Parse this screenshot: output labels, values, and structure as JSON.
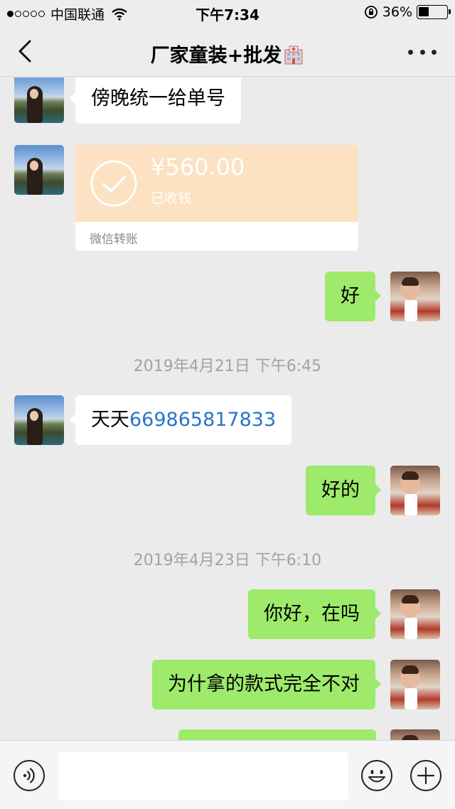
{
  "status_bar": {
    "signal_dots_filled": 1,
    "signal_dots_total": 5,
    "carrier": "中国联通",
    "time": "下午7:34",
    "battery_percent": "36%",
    "battery_level": 0.36
  },
  "nav": {
    "title": "厂家童装+批发",
    "title_emoji": "hospital-icon"
  },
  "messages": [
    {
      "side": "in",
      "text": "傍晚统一给单号"
    },
    {
      "side": "in",
      "type": "transfer",
      "amount": "¥560.00",
      "status": "已收钱",
      "footer": "微信转账"
    },
    {
      "side": "out",
      "text": "好"
    },
    {
      "type": "timestamp",
      "text": "2019年4月21日 下午6:45"
    },
    {
      "side": "in",
      "text_prefix": "天天",
      "link": "669865817833"
    },
    {
      "side": "out",
      "text": "好的"
    },
    {
      "type": "timestamp",
      "text": "2019年4月23日 下午6:10"
    },
    {
      "side": "out",
      "text": "你好，在吗"
    },
    {
      "side": "out",
      "text": "为什拿的款式完全不对"
    }
  ],
  "input_bar": {
    "value": "",
    "icons": [
      "voice-icon",
      "emoji-icon",
      "plus-icon"
    ]
  },
  "colors": {
    "outgoing_bubble": "#9eea6a",
    "incoming_bubble": "#ffffff",
    "transfer_card": "#fce1c2",
    "link": "#2b73c9",
    "background": "#ebebeb"
  }
}
